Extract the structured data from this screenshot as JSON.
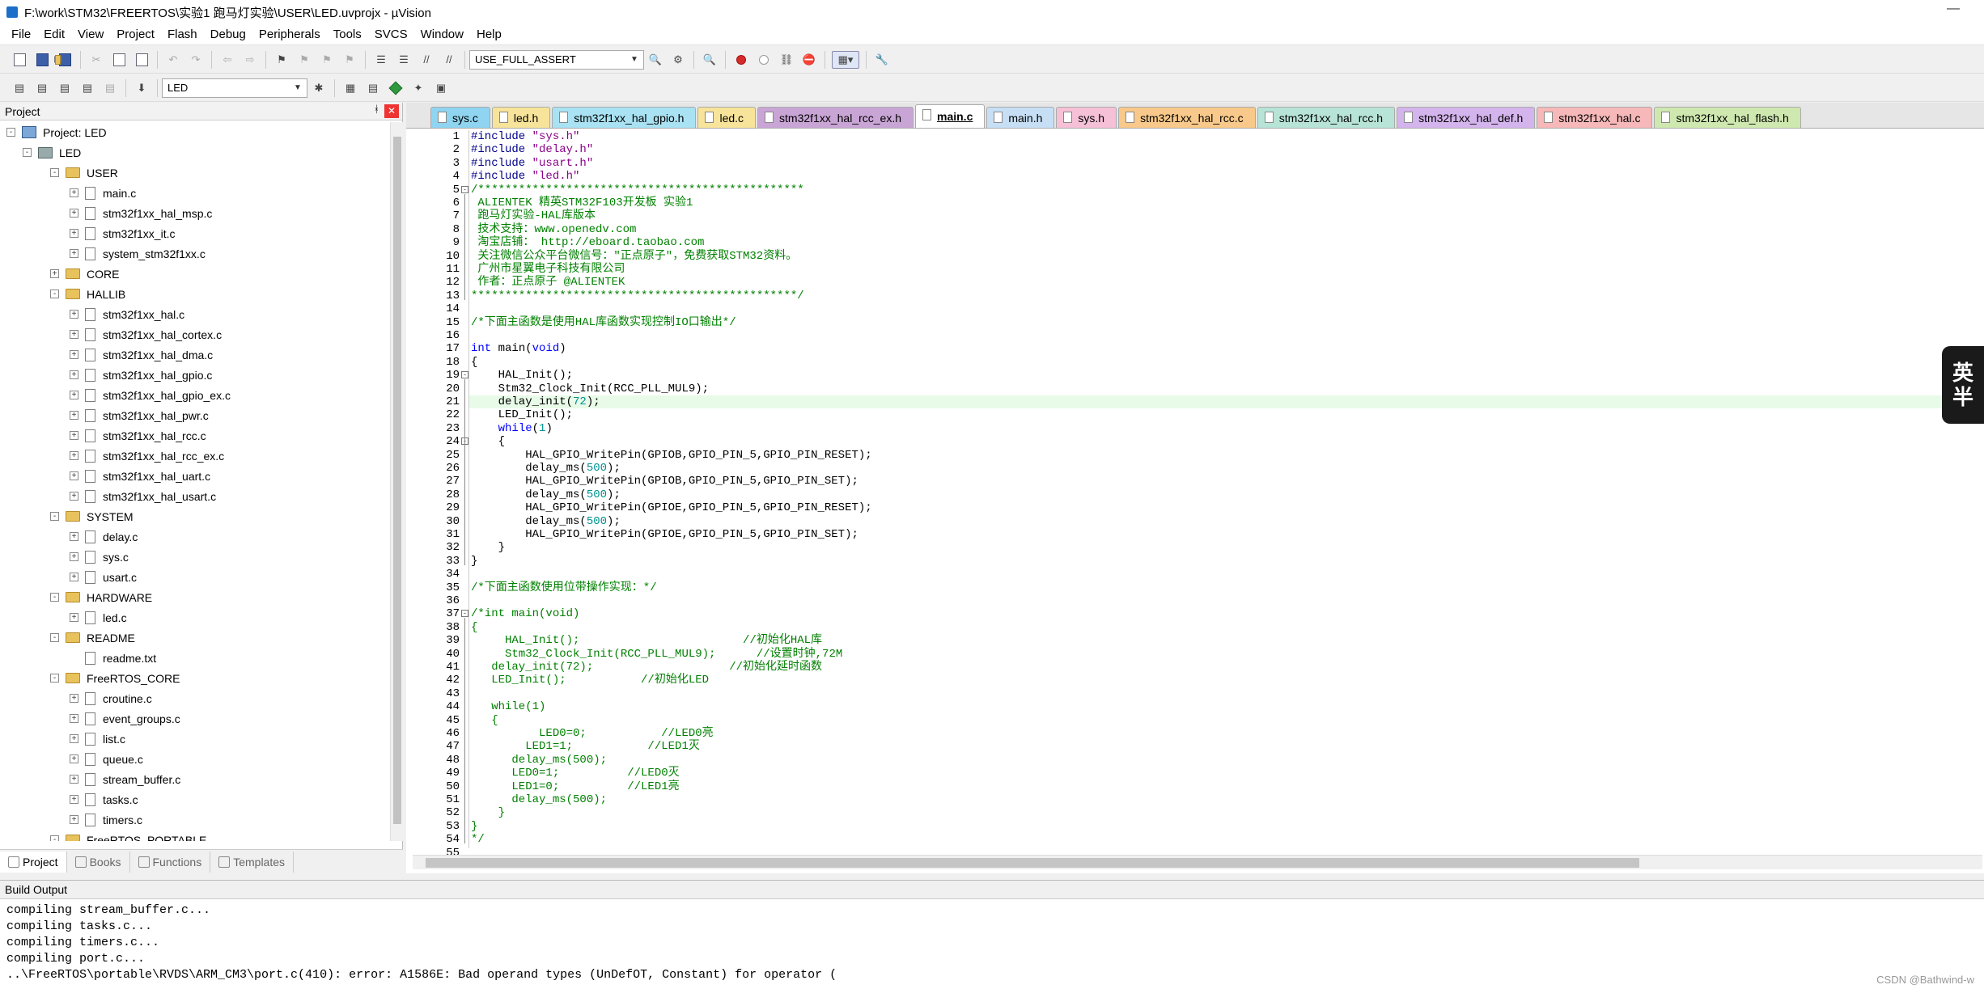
{
  "window": {
    "title": "F:\\work\\STM32\\FREERTOS\\实验1 跑马灯实验\\USER\\LED.uvprojx - µVision",
    "minimize": "—"
  },
  "menu": [
    "File",
    "Edit",
    "View",
    "Project",
    "Flash",
    "Debug",
    "Peripherals",
    "Tools",
    "SVCS",
    "Window",
    "Help"
  ],
  "toolbar": {
    "define_combo": "USE_FULL_ASSERT",
    "target_combo": "LED"
  },
  "project_panel": {
    "title": "Project",
    "pin": "ᚼ",
    "close": "✕",
    "tree": [
      {
        "label": "Project: LED",
        "type": "project",
        "indent": 0,
        "exp": "-"
      },
      {
        "label": "LED",
        "type": "target",
        "indent": 1,
        "exp": "-"
      },
      {
        "label": "USER",
        "type": "folder",
        "indent": 2,
        "exp": "-"
      },
      {
        "label": "main.c",
        "type": "file",
        "indent": 3,
        "exp": "+"
      },
      {
        "label": "stm32f1xx_hal_msp.c",
        "type": "file",
        "indent": 3,
        "exp": "+"
      },
      {
        "label": "stm32f1xx_it.c",
        "type": "file",
        "indent": 3,
        "exp": "+"
      },
      {
        "label": "system_stm32f1xx.c",
        "type": "file",
        "indent": 3,
        "exp": "+"
      },
      {
        "label": "CORE",
        "type": "folder",
        "indent": 2,
        "exp": "+"
      },
      {
        "label": "HALLIB",
        "type": "folder",
        "indent": 2,
        "exp": "-"
      },
      {
        "label": "stm32f1xx_hal.c",
        "type": "file",
        "indent": 3,
        "exp": "+"
      },
      {
        "label": "stm32f1xx_hal_cortex.c",
        "type": "file",
        "indent": 3,
        "exp": "+"
      },
      {
        "label": "stm32f1xx_hal_dma.c",
        "type": "file",
        "indent": 3,
        "exp": "+"
      },
      {
        "label": "stm32f1xx_hal_gpio.c",
        "type": "file",
        "indent": 3,
        "exp": "+"
      },
      {
        "label": "stm32f1xx_hal_gpio_ex.c",
        "type": "file",
        "indent": 3,
        "exp": "+"
      },
      {
        "label": "stm32f1xx_hal_pwr.c",
        "type": "file",
        "indent": 3,
        "exp": "+"
      },
      {
        "label": "stm32f1xx_hal_rcc.c",
        "type": "file",
        "indent": 3,
        "exp": "+"
      },
      {
        "label": "stm32f1xx_hal_rcc_ex.c",
        "type": "file",
        "indent": 3,
        "exp": "+"
      },
      {
        "label": "stm32f1xx_hal_uart.c",
        "type": "file",
        "indent": 3,
        "exp": "+"
      },
      {
        "label": "stm32f1xx_hal_usart.c",
        "type": "file",
        "indent": 3,
        "exp": "+"
      },
      {
        "label": "SYSTEM",
        "type": "folder",
        "indent": 2,
        "exp": "-"
      },
      {
        "label": "delay.c",
        "type": "file",
        "indent": 3,
        "exp": "+"
      },
      {
        "label": "sys.c",
        "type": "file",
        "indent": 3,
        "exp": "+"
      },
      {
        "label": "usart.c",
        "type": "file",
        "indent": 3,
        "exp": "+"
      },
      {
        "label": "HARDWARE",
        "type": "folder",
        "indent": 2,
        "exp": "-"
      },
      {
        "label": "led.c",
        "type": "file",
        "indent": 3,
        "exp": "+"
      },
      {
        "label": "README",
        "type": "folder",
        "indent": 2,
        "exp": "-"
      },
      {
        "label": "readme.txt",
        "type": "file",
        "indent": 3,
        "exp": ""
      },
      {
        "label": "FreeRTOS_CORE",
        "type": "folder",
        "indent": 2,
        "exp": "-"
      },
      {
        "label": "croutine.c",
        "type": "file",
        "indent": 3,
        "exp": "+"
      },
      {
        "label": "event_groups.c",
        "type": "file",
        "indent": 3,
        "exp": "+"
      },
      {
        "label": "list.c",
        "type": "file",
        "indent": 3,
        "exp": "+"
      },
      {
        "label": "queue.c",
        "type": "file",
        "indent": 3,
        "exp": "+"
      },
      {
        "label": "stream_buffer.c",
        "type": "file",
        "indent": 3,
        "exp": "+"
      },
      {
        "label": "tasks.c",
        "type": "file",
        "indent": 3,
        "exp": "+"
      },
      {
        "label": "timers.c",
        "type": "file",
        "indent": 3,
        "exp": "+"
      },
      {
        "label": "FreeRTOS_PORTABLE",
        "type": "folder",
        "indent": 2,
        "exp": "-"
      }
    ],
    "tabs": [
      "Project",
      "Books",
      "Functions",
      "Templates"
    ]
  },
  "editor": {
    "tabs": [
      {
        "label": "sys.c",
        "color": "#8fd4f0"
      },
      {
        "label": "led.h",
        "color": "#f7e49a"
      },
      {
        "label": "stm32f1xx_hal_gpio.h",
        "color": "#a9e2f3"
      },
      {
        "label": "led.c",
        "color": "#f7e49a"
      },
      {
        "label": "stm32f1xx_hal_rcc_ex.h",
        "color": "#c9a5d6"
      },
      {
        "label": "main.c",
        "color": "#ffffff",
        "active": true
      },
      {
        "label": "main.h",
        "color": "#c7dff5"
      },
      {
        "label": "sys.h",
        "color": "#f6c0d6"
      },
      {
        "label": "stm32f1xx_hal_rcc.c",
        "color": "#f8c98a"
      },
      {
        "label": "stm32f1xx_hal_rcc.h",
        "color": "#b7e4d6"
      },
      {
        "label": "stm32f1xx_hal_def.h",
        "color": "#d4b4ec"
      },
      {
        "label": "stm32f1xx_hal.c",
        "color": "#f6b8b8"
      },
      {
        "label": "stm32f1xx_hal_flash.h",
        "color": "#cfe8b0"
      }
    ],
    "lines": [
      [
        [
          "pp",
          "#include "
        ],
        [
          "str",
          "\"sys.h\""
        ]
      ],
      [
        [
          "pp",
          "#include "
        ],
        [
          "str",
          "\"delay.h\""
        ]
      ],
      [
        [
          "pp",
          "#include "
        ],
        [
          "str",
          "\"usart.h\""
        ]
      ],
      [
        [
          "pp",
          "#include "
        ],
        [
          "str",
          "\"led.h\""
        ]
      ],
      [
        [
          "cmt",
          "/************************************************"
        ]
      ],
      [
        [
          "cmt",
          " ALIENTEK 精英STM32F103开发板 实验1"
        ]
      ],
      [
        [
          "cmt",
          " 跑马灯实验-HAL库版本"
        ]
      ],
      [
        [
          "cmt",
          " 技术支持：www.openedv.com"
        ]
      ],
      [
        [
          "cmt",
          " 淘宝店铺： http://eboard.taobao.com"
        ]
      ],
      [
        [
          "cmt",
          " 关注微信公众平台微信号：\"正点原子\"，免费获取STM32资料。"
        ]
      ],
      [
        [
          "cmt",
          " 广州市星翼电子科技有限公司"
        ]
      ],
      [
        [
          "cmt",
          " 作者：正点原子 @ALIENTEK"
        ]
      ],
      [
        [
          "cmt",
          "************************************************/"
        ]
      ],
      [
        [
          "",
          ""
        ]
      ],
      [
        [
          "cmt",
          "/*下面主函数是使用HAL库函数实现控制IO口输出*/"
        ]
      ],
      [
        [
          "",
          ""
        ]
      ],
      [
        [
          "kw",
          "int"
        ],
        [
          "",
          " main("
        ],
        [
          "kw",
          "void"
        ],
        [
          "",
          ")"
        ]
      ],
      [
        [
          "",
          "{"
        ]
      ],
      [
        [
          "",
          "    HAL_Init();"
        ]
      ],
      [
        [
          "",
          "    Stm32_Clock_Init(RCC_PLL_MUL9);"
        ]
      ],
      [
        [
          "",
          "    delay_init("
        ],
        [
          "num",
          "72"
        ],
        [
          "",
          ");"
        ]
      ],
      [
        [
          "",
          "    LED_Init();"
        ]
      ],
      [
        [
          "",
          "    "
        ],
        [
          "kw",
          "while"
        ],
        [
          "",
          "("
        ],
        [
          "num",
          "1"
        ],
        [
          "",
          ")"
        ]
      ],
      [
        [
          "",
          "    {"
        ]
      ],
      [
        [
          "",
          "        HAL_GPIO_WritePin(GPIOB,GPIO_PIN_5,GPIO_PIN_RESET);"
        ]
      ],
      [
        [
          "",
          "        delay_ms("
        ],
        [
          "num",
          "500"
        ],
        [
          "",
          ");"
        ]
      ],
      [
        [
          "",
          "        HAL_GPIO_WritePin(GPIOB,GPIO_PIN_5,GPIO_PIN_SET);"
        ]
      ],
      [
        [
          "",
          "        delay_ms("
        ],
        [
          "num",
          "500"
        ],
        [
          "",
          ");"
        ]
      ],
      [
        [
          "",
          "        HAL_GPIO_WritePin(GPIOE,GPIO_PIN_5,GPIO_PIN_RESET);"
        ]
      ],
      [
        [
          "",
          "        delay_ms("
        ],
        [
          "num",
          "500"
        ],
        [
          "",
          ");"
        ]
      ],
      [
        [
          "",
          "        HAL_GPIO_WritePin(GPIOE,GPIO_PIN_5,GPIO_PIN_SET);"
        ]
      ],
      [
        [
          "",
          "    }"
        ]
      ],
      [
        [
          "",
          "}"
        ]
      ],
      [
        [
          "",
          ""
        ]
      ],
      [
        [
          "cmt",
          "/*下面主函数使用位带操作实现：*/"
        ]
      ],
      [
        [
          "",
          ""
        ]
      ],
      [
        [
          "cmt",
          "/*int main(void)"
        ]
      ],
      [
        [
          "cmt",
          "{"
        ]
      ],
      [
        [
          "cmt",
          "     HAL_Init();                        //初始化HAL库"
        ]
      ],
      [
        [
          "cmt",
          "     Stm32_Clock_Init(RCC_PLL_MUL9);      //设置时钟,72M"
        ]
      ],
      [
        [
          "cmt",
          "   delay_init(72);                    //初始化延时函数"
        ]
      ],
      [
        [
          "cmt",
          "   LED_Init();           //初始化LED"
        ]
      ],
      [
        [
          "",
          ""
        ]
      ],
      [
        [
          "cmt",
          "   while(1)"
        ]
      ],
      [
        [
          "cmt",
          "   {"
        ]
      ],
      [
        [
          "cmt",
          "          LED0=0;           //LED0亮"
        ]
      ],
      [
        [
          "cmt",
          "        LED1=1;           //LED1灭"
        ]
      ],
      [
        [
          "cmt",
          "      delay_ms(500);"
        ]
      ],
      [
        [
          "cmt",
          "      LED0=1;          //LED0灭"
        ]
      ],
      [
        [
          "cmt",
          "      LED1=0;          //LED1亮"
        ]
      ],
      [
        [
          "cmt",
          "      delay_ms(500);"
        ]
      ],
      [
        [
          "cmt",
          "    }"
        ]
      ],
      [
        [
          "cmt",
          "}"
        ]
      ],
      [
        [
          "cmt",
          "*/"
        ]
      ],
      [
        [
          "",
          ""
        ]
      ]
    ],
    "highlight_line": 21,
    "fold_lines": [
      5,
      19,
      24,
      37
    ]
  },
  "ime": {
    "top": "英",
    "bottom": "半"
  },
  "build": {
    "title": "Build Output",
    "lines": [
      "compiling stream_buffer.c...",
      "compiling tasks.c...",
      "compiling timers.c...",
      "compiling port.c...",
      "..\\FreeRTOS\\portable\\RVDS\\ARM_CM3\\port.c(410): error: A1586E: Bad operand types (UnDefOT, Constant) for operator ("
    ]
  },
  "watermark": "CSDN @Bathwind-w"
}
